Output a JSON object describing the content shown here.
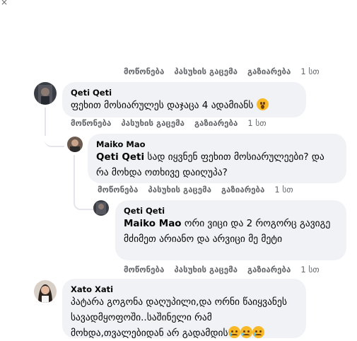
{
  "close_glyph": "×",
  "actions": {
    "like": "მოწონება",
    "reply": "პასუხის გაცემა",
    "share": "გაზიარება"
  },
  "top_actions": {
    "time": "1 სთ"
  },
  "comments": [
    {
      "author": "Qeti Qeti",
      "text": "ფეხით მოსიარულეს დაჯაცა 4 ადამიანს",
      "emoji": "wow-emoji",
      "time": "1 სთ"
    },
    {
      "author": "Maiko Mao",
      "mention": "Qeti Qeti",
      "text": " სად იყვნენ ფეხით მოსიარულეები? და რა მოხდა ოთხივე დაიღუპა?",
      "time": "1 სთ"
    },
    {
      "author": "Qeti Qeti",
      "mention": "Maiko Mao",
      "text": " ორი ვიცი და 2 როგორც გავიგე მძიმეთ არიანო და არვიცი მე მეტი",
      "time": "1 სთ"
    },
    {
      "author": "Xato Xati",
      "text": "პატარა გოგონა დაღუპილი,და ორნი წაიყვანეს სავადმყოფოში..საშინელი რამ მოხდა,თვალებიდან არ გადამდის",
      "emoji": "sad-emoji"
    }
  ],
  "colors": {
    "bubble": "#f0f2f5",
    "meta": "#65676b",
    "text": "#050505"
  }
}
